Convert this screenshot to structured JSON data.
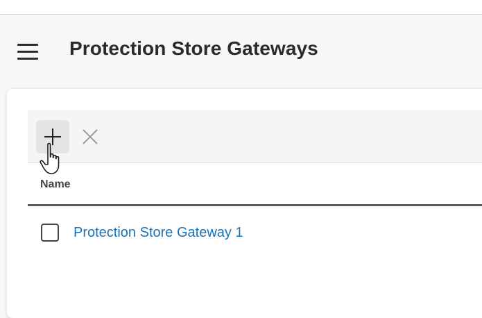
{
  "header": {
    "title": "Protection Store Gateways",
    "menu_icon": "hamburger-menu-icon"
  },
  "toolbar": {
    "add_icon": "plus-icon",
    "delete_icon": "close-icon"
  },
  "table": {
    "columns": [
      "Name"
    ],
    "rows": [
      {
        "name": "Protection Store Gateway 1",
        "checked": false
      }
    ]
  },
  "colors": {
    "link": "#1a73b6",
    "title": "#2b2b2b",
    "toolbar_bg": "#f5f5f5",
    "add_button_bg": "#e3e3e3"
  }
}
